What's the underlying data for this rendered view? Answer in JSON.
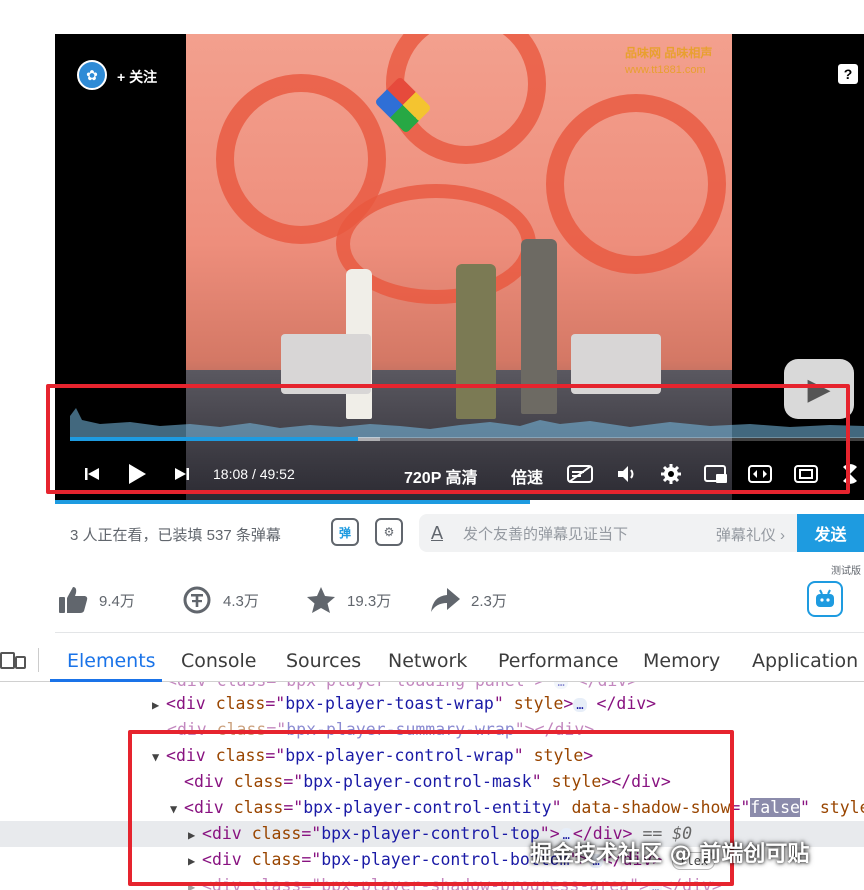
{
  "player": {
    "follow_label": "+ 关注",
    "help_label": "?",
    "video_watermark_line1": "品味网 品味相声",
    "video_watermark_line2": "www.tt1881.com",
    "progress_fraction": 0.363,
    "buffer_fraction": 0.39,
    "current_time": "18:08",
    "time_separator": "/",
    "duration": "49:52",
    "quality_label": "720P 高清",
    "speed_label": "倍速",
    "accent_color": "#1e9be0"
  },
  "danmaku": {
    "viewer_text": "3 人正在看，已装填 537 条弹幕",
    "toggle_label": "弹",
    "input_icon": "A",
    "placeholder": "发个友善的弹幕见证当下",
    "etiquette_label": "弹幕礼仪 ›",
    "send_label": "发送"
  },
  "actions": {
    "like_count": "9.4万",
    "coin_count": "4.3万",
    "favorite_count": "19.3万",
    "share_count": "2.3万",
    "beta_label": "测试版"
  },
  "devtools": {
    "tabs": [
      "Elements",
      "Console",
      "Sources",
      "Network",
      "Performance",
      "Memory",
      "Application"
    ],
    "active_tab": "Elements",
    "lines": [
      {
        "text_before": "<div class=\"bpx-player-loading-panel\">",
        "ellipsis": "…",
        "text_after": "</div>"
      },
      {
        "open": "div",
        "attr": "class",
        "value": "bpx-player-toast-wrap",
        "extra_attr": "style",
        "ellipsis": "…",
        "close": "</div>"
      },
      {
        "open": "div",
        "attr": "class",
        "value": "bpx-player-summary-wrap",
        "close": "></div>"
      },
      {
        "open": "div",
        "attr": "class",
        "value": "bpx-player-control-wrap",
        "extra_attr": "style"
      },
      {
        "open": "div",
        "attr": "class",
        "value": "bpx-player-control-mask",
        "extra_attr": "style",
        "close": "></div>"
      },
      {
        "open": "div",
        "attr": "class",
        "value": "bpx-player-control-entity",
        "extra_attr": "data-shadow-show",
        "extra_value": "false",
        "trail_attr": "style"
      },
      {
        "open": "div",
        "attr": "class",
        "value": "bpx-player-control-top",
        "ellipsis": "…",
        "close": "</div>",
        "eq_marker": "== $0"
      },
      {
        "open": "div",
        "attr": "class",
        "value": "bpx-player-control-bottom",
        "ellipsis": "…",
        "close": "</div>",
        "badge": "flex"
      },
      {
        "text_before": "<div class=\"bpx-player-shadow-progress-area\">",
        "ellipsis": "…",
        "text_after": "</div>"
      }
    ]
  },
  "site_watermark": "掘金技术社区 @ 前端创可贴"
}
